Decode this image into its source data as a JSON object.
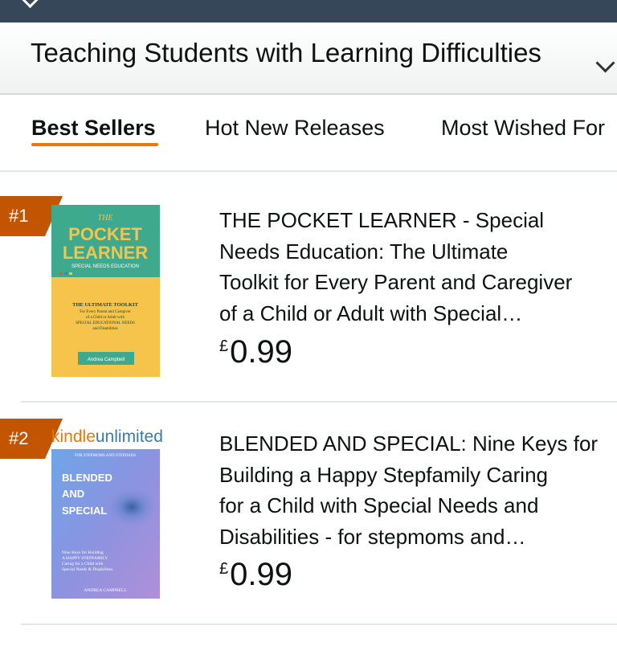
{
  "category": {
    "title": "Teaching Students with Learning Difficulties"
  },
  "tabs": [
    {
      "label": "Best Sellers"
    },
    {
      "label": "Hot New Releases"
    },
    {
      "label": "Most Wished For"
    }
  ],
  "colors": {
    "accent": "#e47911",
    "rank_badge": "#c45500",
    "topbar": "#37475a"
  },
  "items": [
    {
      "rank": "#1",
      "title_lines": [
        "THE POCKET LEARNER - Special",
        "Needs Education: The Ultimate",
        "Toolkit for Every Parent and Caregiver",
        "of a Child or Adult with Special…"
      ],
      "currency": "£",
      "price": "0.99",
      "cover": {
        "the": "THE",
        "title_line1": "POCKET",
        "title_line2": "LEARNER",
        "subtitle": "SPECIAL NEEDS EDUCATION",
        "tagline_1": "THE ULTIMATE TOOLKIT",
        "tagline_2": "For Every Parent and Caregiver",
        "tagline_3": "of a Child or Adult with",
        "tagline_4": "SPECIAL EDUCATIONAL NEEDS",
        "tagline_5": "and Disabilities",
        "author": "Andrea Campbell"
      }
    },
    {
      "rank": "#2",
      "badge_kindle": "kindle",
      "badge_unlimited": "unlimited",
      "title_lines": [
        "BLENDED AND SPECIAL: Nine Keys for",
        "Building a Happy Stepfamily Caring",
        "for a Child with Special Needs and",
        "Disabilities - for stepmoms and…"
      ],
      "currency": "£",
      "price": "0.99",
      "cover": {
        "top": "FOR STEPMOMS AND STEPDADS",
        "title_line1": "BLENDED",
        "title_line2": "AND",
        "title_line3": "SPECIAL",
        "blurb_1": "Nine Keys for Building",
        "blurb_2": "A HAPPY STEPFAMILY",
        "blurb_3": "Caring for a Child with",
        "blurb_4": "Special Needs & Disabilities",
        "author": "ANDREA CAMPBELL"
      }
    }
  ]
}
